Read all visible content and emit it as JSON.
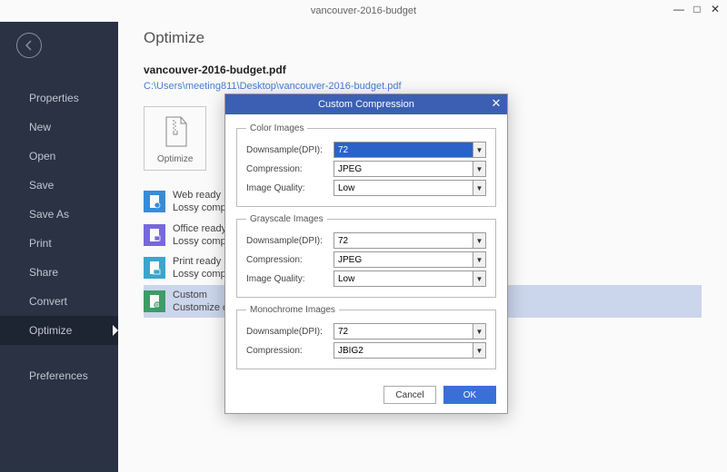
{
  "window": {
    "title": "vancouver-2016-budget"
  },
  "page": {
    "heading": "Optimize"
  },
  "file": {
    "name": "vancouver-2016-budget.pdf",
    "path": "C:\\Users\\meeting811\\Desktop\\vancouver-2016-budget.pdf"
  },
  "sidebar": {
    "items": [
      {
        "label": "Properties"
      },
      {
        "label": "New"
      },
      {
        "label": "Open"
      },
      {
        "label": "Save"
      },
      {
        "label": "Save As"
      },
      {
        "label": "Print"
      },
      {
        "label": "Share"
      },
      {
        "label": "Convert"
      },
      {
        "label": "Optimize"
      },
      {
        "label": "Preferences"
      }
    ]
  },
  "optimizeTile": {
    "label": "Optimize",
    "panelGlyph": "C"
  },
  "presets": [
    {
      "title": "Web ready（si",
      "sub": "Lossy compres"
    },
    {
      "title": "Office ready（",
      "sub": "Lossy compres"
    },
    {
      "title": "Print ready（la",
      "sub": "Lossy compres"
    },
    {
      "title": "Custom",
      "sub": "Customize cor"
    }
  ],
  "modal": {
    "title": "Custom Compression",
    "groups": {
      "color": {
        "legend": "Color Images",
        "downsample_label": "Downsample(DPI):",
        "downsample_val": "72",
        "compression_label": "Compression:",
        "compression_val": "JPEG",
        "quality_label": "Image Quality:",
        "quality_val": "Low"
      },
      "gray": {
        "legend": "Grayscale Images",
        "downsample_label": "Downsample(DPI):",
        "downsample_val": "72",
        "compression_label": "Compression:",
        "compression_val": "JPEG",
        "quality_label": "Image Quality:",
        "quality_val": "Low"
      },
      "mono": {
        "legend": "Monochrome Images",
        "downsample_label": "Downsample(DPI):",
        "downsample_val": "72",
        "compression_label": "Compression:",
        "compression_val": "JBIG2"
      }
    },
    "buttons": {
      "cancel": "Cancel",
      "ok": "OK"
    }
  }
}
